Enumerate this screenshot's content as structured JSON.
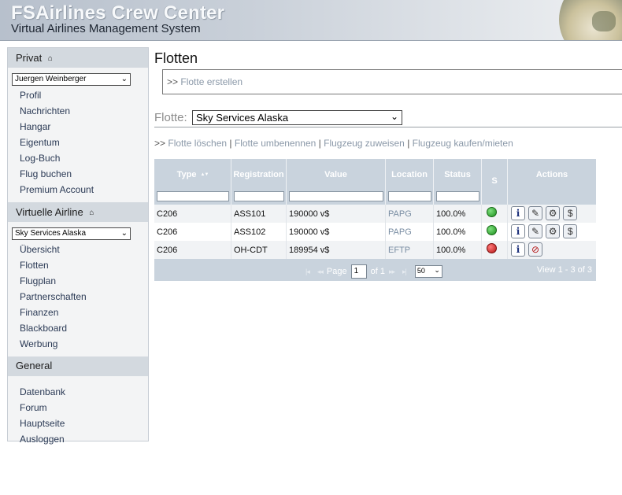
{
  "header": {
    "title": "FSAirlines Crew Center",
    "subtitle": "Virtual Airlines Management System"
  },
  "sidebar": {
    "private": {
      "heading": "Privat",
      "user_select": "Juergen Weinberger",
      "items": [
        "Profil",
        "Nachrichten",
        "Hangar",
        "Eigentum",
        "Log-Buch",
        "Flug buchen",
        "Premium Account"
      ]
    },
    "virtual_airline": {
      "heading": "Virtuelle Airline",
      "airline_select": "Sky Services Alaska",
      "items": [
        "Übersicht",
        "Flotten",
        "Flugplan",
        "Partnerschaften",
        "Finanzen",
        "Blackboard",
        "Werbung"
      ]
    },
    "general": {
      "heading": "General",
      "items": [
        "Datenbank",
        "Forum",
        "Hauptseite",
        "Ausloggen"
      ]
    }
  },
  "main": {
    "title": "Flotten",
    "create_prefix": ">>",
    "create_link": "Flotte erstellen",
    "fleet_label": "Flotte:",
    "fleet_select": "Sky Services Alaska",
    "actions_prefix": ">>",
    "actions": [
      "Flotte löschen",
      "Flotte umbenennen",
      "Flugzeug zuweisen",
      "Flugzeug kaufen/mieten"
    ],
    "action_separator": "|"
  },
  "grid": {
    "columns": [
      "Type",
      "Registration",
      "Value",
      "Location",
      "Status",
      "S",
      "Actions"
    ],
    "sort_indicator": "▲▼",
    "rows": [
      {
        "type": "C206",
        "registration": "ASS101",
        "value": "190000 v$",
        "location": "PAPG",
        "status": "100.0%",
        "s": "ok",
        "actions": [
          "info",
          "repair",
          "maintenance",
          "sell"
        ]
      },
      {
        "type": "C206",
        "registration": "ASS102",
        "value": "190000 v$",
        "location": "PAPG",
        "status": "100.0%",
        "s": "ok",
        "actions": [
          "info",
          "repair",
          "maintenance",
          "sell"
        ]
      },
      {
        "type": "C206",
        "registration": "OH-CDT",
        "value": "189954 v$",
        "location": "EFTP",
        "status": "100.0%",
        "s": "bad",
        "actions": [
          "info",
          "remove"
        ]
      }
    ],
    "pager": {
      "page_label": "Page",
      "page_value": "1",
      "of_label": "of 1",
      "rows_per_page": "50",
      "view_info": "View 1 - 3 of 3"
    }
  },
  "colors": {
    "header_bg": "#c9d0d9",
    "sidebar_head_bg": "#d3d9df",
    "grid_head_bg": "#c9d3dd",
    "link_muted": "#8a98a8",
    "status_ok": "#1c8f1c",
    "status_bad": "#b31414"
  }
}
